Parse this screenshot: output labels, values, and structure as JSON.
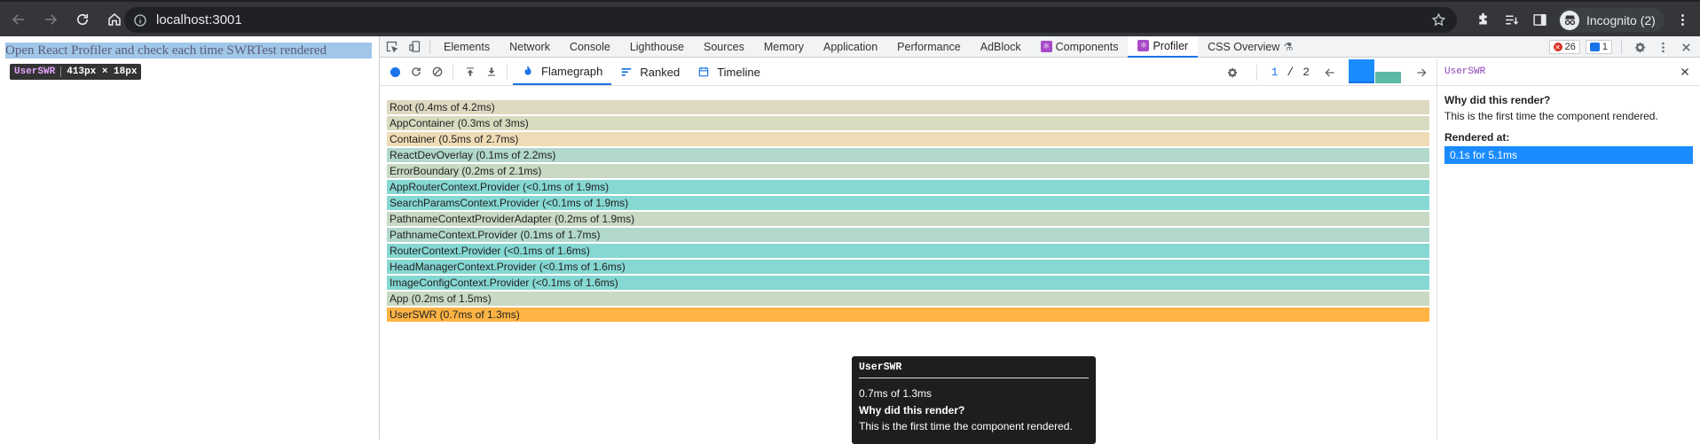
{
  "browser": {
    "url": "localhost:3001",
    "profile_label": "Incognito (2)",
    "icons": [
      "back-icon",
      "forward-icon",
      "reload-icon",
      "home-icon",
      "info-icon",
      "star-icon",
      "extensions-icon",
      "reading-list-icon",
      "side-panel-icon",
      "incognito-icon",
      "menu-icon"
    ]
  },
  "page": {
    "highlighted_text": "Open React Profiler and check each time SWRTest rendered",
    "inspect_tip": {
      "name": "UserSWR",
      "size": "413px × 18px"
    }
  },
  "devtools": {
    "tabs": [
      {
        "label": "Elements"
      },
      {
        "label": "Network"
      },
      {
        "label": "Console"
      },
      {
        "label": "Lighthouse"
      },
      {
        "label": "Sources"
      },
      {
        "label": "Memory"
      },
      {
        "label": "Application"
      },
      {
        "label": "Performance"
      },
      {
        "label": "AdBlock"
      },
      {
        "label": "Components"
      },
      {
        "label": "Profiler"
      },
      {
        "label": "CSS Overview"
      }
    ],
    "active_tab": "Profiler",
    "error_count": "26",
    "message_count": "1"
  },
  "profiler": {
    "views": [
      {
        "label": "Flamegraph"
      },
      {
        "label": "Ranked"
      },
      {
        "label": "Timeline"
      }
    ],
    "active_view": "Flamegraph",
    "commit_current": "1",
    "commit_total": "2",
    "commit_durations_relative": [
      1.0,
      0.48
    ],
    "flamegraph": [
      {
        "label": "Root (0.4ms of 4.2ms)",
        "color": "#ddd8c0"
      },
      {
        "label": "AppContainer (0.3ms of 3ms)",
        "color": "#d9dbc0"
      },
      {
        "label": "Container (0.5ms of 2.7ms)",
        "color": "#efdcb6"
      },
      {
        "label": "ReactDevOverlay (0.1ms of 2.2ms)",
        "color": "#b2d8cd"
      },
      {
        "label": "ErrorBoundary (0.2ms of 2.1ms)",
        "color": "#c8d9c4"
      },
      {
        "label": "AppRouterContext.Provider (<0.1ms of 1.9ms)",
        "color": "#86d8d2"
      },
      {
        "label": "SearchParamsContext.Provider (<0.1ms of 1.9ms)",
        "color": "#86d8d2"
      },
      {
        "label": "PathnameContextProviderAdapter (0.2ms of 1.9ms)",
        "color": "#c8d9c4"
      },
      {
        "label": "PathnameContext.Provider (0.1ms of 1.7ms)",
        "color": "#b2d8cd"
      },
      {
        "label": "RouterContext.Provider (<0.1ms of 1.6ms)",
        "color": "#86d8d2"
      },
      {
        "label": "HeadManagerContext.Provider (<0.1ms of 1.6ms)",
        "color": "#86d8d2"
      },
      {
        "label": "ImageConfigContext.Provider (<0.1ms of 1.6ms)",
        "color": "#86d8d2"
      },
      {
        "label": "App (0.2ms of 1.5ms)",
        "color": "#c8d9c4"
      },
      {
        "label": "UserSWR (0.7ms of 1.3ms)",
        "color": "#fdb444"
      }
    ],
    "tooltip": {
      "title": "UserSWR",
      "duration": "0.7ms of 1.3ms",
      "question": "Why did this render?",
      "reason": "This is the first time the component rendered."
    },
    "sidebar": {
      "component": "UserSWR",
      "why_label": "Why did this render?",
      "why_text": "This is the first time the component rendered.",
      "rendered_at_label": "Rendered at:",
      "rendered_at_value": "0.1s for 5.1ms"
    }
  }
}
